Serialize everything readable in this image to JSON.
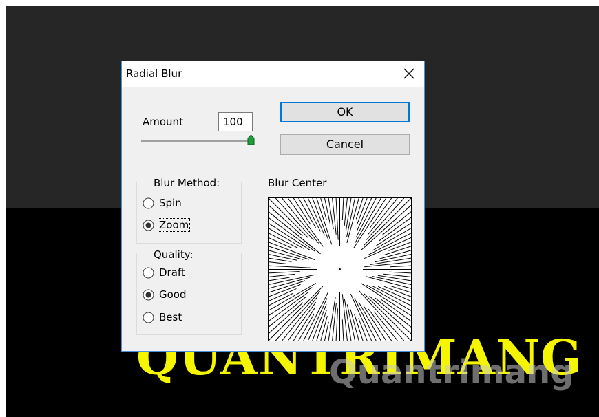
{
  "background": {
    "canvas_text": "QUANTRIMANG",
    "watermark": "Quantrimang"
  },
  "dialog": {
    "title": "Radial Blur",
    "amount_label": "Amount",
    "amount_value": "100",
    "amount_slider_value": 100,
    "ok_label": "OK",
    "cancel_label": "Cancel",
    "blur_method": {
      "title": "Blur Method:",
      "options": [
        "Spin",
        "Zoom"
      ],
      "selected": "Zoom"
    },
    "quality": {
      "title": "Quality:",
      "options": [
        "Draft",
        "Good",
        "Best"
      ],
      "selected": "Good"
    },
    "blur_center_label": "Blur Center"
  },
  "colors": {
    "accent": "#0078d7",
    "canvas_text": "#f5f500",
    "dialog_bg": "#f0f0f0",
    "canvas_top": "#262626"
  }
}
